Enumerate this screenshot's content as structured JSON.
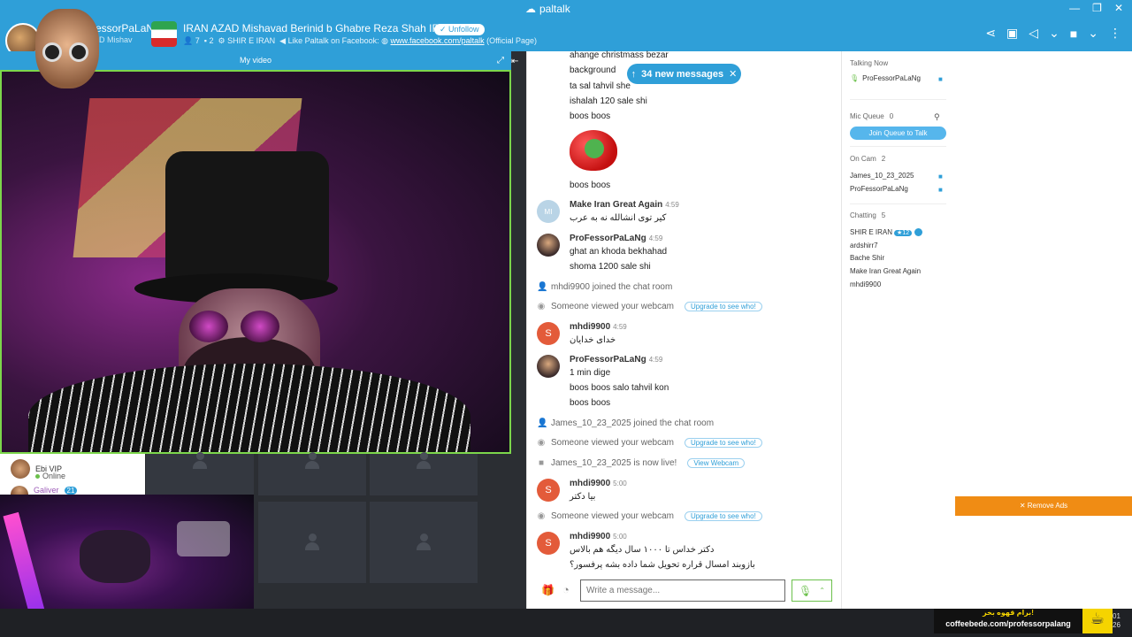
{
  "app": {
    "brand": "paltalk"
  },
  "window": {
    "minimize": "—",
    "maximize": "❐",
    "close": "✕"
  },
  "header": {
    "username": "rofessorPaLaNg",
    "user_sub": "AD Mishav",
    "room_title": "IRAN AZAD Mishavad Berinid b Ghabre Reza Shah IRAN",
    "unfollow": "Unfollow",
    "users_count": "7",
    "mic_count": "2",
    "owner": "SHIR E IRAN",
    "facebook_prefix": "Like Paltalk on Facebook:",
    "facebook_link": "www.facebook.com/paltalk",
    "facebook_suffix": "(Official Page)"
  },
  "video": {
    "my_video_label": "My video"
  },
  "side_users": [
    {
      "name": "Ebi VIP",
      "status": "Online"
    },
    {
      "name": "Galiver",
      "badge": "21"
    }
  ],
  "chat": {
    "new_messages": "34 new messages",
    "lines_top": [
      "ahange christmass bezar",
      "background",
      "ta sal tahvil she",
      "ishalah 120 sale shi",
      "boos boos"
    ],
    "after_sticker": "boos boos",
    "m1": {
      "name": "Make Iran Great Again",
      "time": "4:59",
      "avatar": "MI",
      "text": "کیر توی انشالله نه به عرب"
    },
    "m2": {
      "name": "ProFessorPaLaNg",
      "time": "4:59",
      "lines": [
        "ghat an khoda bekhahad",
        "shoma 1200 sale shi"
      ]
    },
    "sys1": "mhdi9900 joined the chat room",
    "sys2": "Someone viewed your webcam",
    "upgrade": "Upgrade to see who!",
    "m3": {
      "name": "mhdi9900",
      "time": "4:59",
      "avatar": "S",
      "text": "خدای خدایان"
    },
    "m4": {
      "name": "ProFessorPaLaNg",
      "time": "4:59",
      "lines": [
        "1 min dige",
        "boos boos salo tahvil kon",
        "boos boos"
      ]
    },
    "sys3": "James_10_23_2025 joined the chat room",
    "sys4": "Someone viewed your webcam",
    "sys5": "James_10_23_2025 is now live!",
    "view_webcam": "View Webcam",
    "m5": {
      "name": "mhdi9900",
      "time": "5:00",
      "avatar": "S",
      "text": "بیا دکتر"
    },
    "sys6": "Someone viewed your webcam",
    "m6": {
      "name": "mhdi9900",
      "time": "5:00",
      "avatar": "S",
      "lines": [
        "دکتر خداس تا ۱۰۰۰ سال دیگه هم بالاس",
        "بازوبند امسال قراره تحویل شما داده بشه پرفسور؟"
      ]
    },
    "input_placeholder": "Write a message..."
  },
  "right_panel": {
    "talking_now": "Talking Now",
    "talker": "ProFessorPaLaNg",
    "mic_queue": "Mic Queue",
    "mic_queue_count": "0",
    "join_queue": "Join Queue to Talk",
    "on_cam": "On Cam",
    "on_cam_count": "2",
    "cam_users": [
      "James_10_23_2025",
      "ProFessorPaLaNg"
    ],
    "chatting": "Chatting",
    "chatting_count": "5",
    "chat_users": [
      "SHIR E IRAN",
      "ardshirr7",
      "Bache Shir",
      "Make Iran Great Again",
      "mhdi9900"
    ],
    "shir_badge": "12"
  },
  "ads": {
    "remove_ads": "Remove Ads",
    "banner_fa": "برام قهوه بخر!",
    "banner_link": "coffeebede.com/professorpalang"
  },
  "clock": {
    "line1": "01",
    "line2": "26"
  }
}
